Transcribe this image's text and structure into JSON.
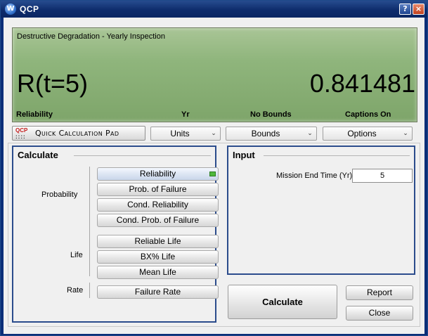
{
  "window": {
    "title": "QCP",
    "app_icon_glyph": "W",
    "help_glyph": "?",
    "close_glyph": "×"
  },
  "display": {
    "header": "Destructive Degradation - Yearly Inspection",
    "result_label": "R(t=5)",
    "result_value": "0.841481",
    "footer": {
      "metric": "Reliability",
      "units": "Yr",
      "bounds": "No Bounds",
      "captions": "Captions On"
    }
  },
  "toolbar": {
    "qcp_logo_top": "QCP",
    "qcp_logo_bottom": "::::",
    "qcp_label": "Quick Calculation Pad",
    "units_label": "Units",
    "bounds_label": "Bounds",
    "options_label": "Options",
    "chevron_glyph": "⌄"
  },
  "calculate": {
    "title": "Calculate",
    "groups": {
      "probability": "Probability",
      "life": "Life",
      "rate": "Rate"
    },
    "buttons": {
      "reliability": "Reliability",
      "prob_failure": "Prob. of Failure",
      "cond_reliability": "Cond. Reliability",
      "cond_prob_failure": "Cond. Prob. of Failure",
      "reliable_life": "Reliable Life",
      "bx_life": "BX% Life",
      "mean_life": "Mean Life",
      "failure_rate": "Failure Rate"
    },
    "selected": "reliability"
  },
  "input": {
    "title": "Input",
    "mission_label": "Mission End Time (Yr)",
    "mission_value": "5"
  },
  "actions": {
    "calculate": "Calculate",
    "report": "Report",
    "close": "Close"
  },
  "colors": {
    "display_bg": "#8fb57c",
    "panel_border": "#2b4c8c",
    "titlebar": "#0e2c6c",
    "selected_indicator": "#4fb83c"
  }
}
